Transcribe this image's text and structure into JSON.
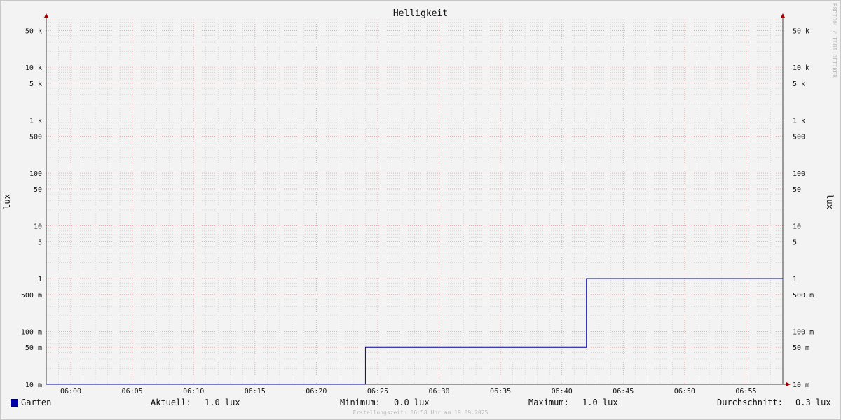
{
  "title": "Helligkeit",
  "watermark": "RRDTOOL / TOBI OETIKER",
  "footer": "Erstellungszeit: 06:58 Uhr am 19.09.2025",
  "colors": {
    "series": "#0000a8",
    "grid_major": "#f0a0a0",
    "grid_minor": "#c8c8c8",
    "axis": "#404040",
    "arrow": "#a00000"
  },
  "legend": {
    "series_name": "Garten",
    "current_label": "Aktuell:",
    "current_value": "1.0 lux",
    "min_label": "Minimum:",
    "min_value": "0.0 lux",
    "max_label": "Maximum:",
    "max_value": "1.0 lux",
    "avg_label": "Durchschnitt:",
    "avg_value": "0.3 lux"
  },
  "chart_data": {
    "type": "line",
    "title": "Helligkeit",
    "ylabel": "lux",
    "yscale": "log",
    "ylim": [
      0.01,
      80000
    ],
    "xlim": [
      "05:58",
      "06:58"
    ],
    "grid": true,
    "x_ticks": [
      "06:00",
      "06:05",
      "06:10",
      "06:15",
      "06:20",
      "06:25",
      "06:30",
      "06:35",
      "06:40",
      "06:45",
      "06:50",
      "06:55"
    ],
    "y_ticks": [
      {
        "value": 0.01,
        "label": "10 m"
      },
      {
        "value": 0.05,
        "label": "50 m"
      },
      {
        "value": 0.1,
        "label": "100 m"
      },
      {
        "value": 0.5,
        "label": "500 m"
      },
      {
        "value": 1,
        "label": "1"
      },
      {
        "value": 5,
        "label": "5"
      },
      {
        "value": 10,
        "label": "10"
      },
      {
        "value": 50,
        "label": "50"
      },
      {
        "value": 100,
        "label": "100"
      },
      {
        "value": 500,
        "label": "500"
      },
      {
        "value": 1000,
        "label": "1 k"
      },
      {
        "value": 5000,
        "label": "5 k"
      },
      {
        "value": 10000,
        "label": "10 k"
      },
      {
        "value": 50000,
        "label": "50 k"
      }
    ],
    "series": [
      {
        "name": "Garten",
        "step": true,
        "points": [
          {
            "x": "05:58",
            "y": 0
          },
          {
            "x": "06:24",
            "y": 0.05
          },
          {
            "x": "06:42",
            "y": 1
          },
          {
            "x": "06:58",
            "y": 1
          }
        ]
      }
    ]
  }
}
